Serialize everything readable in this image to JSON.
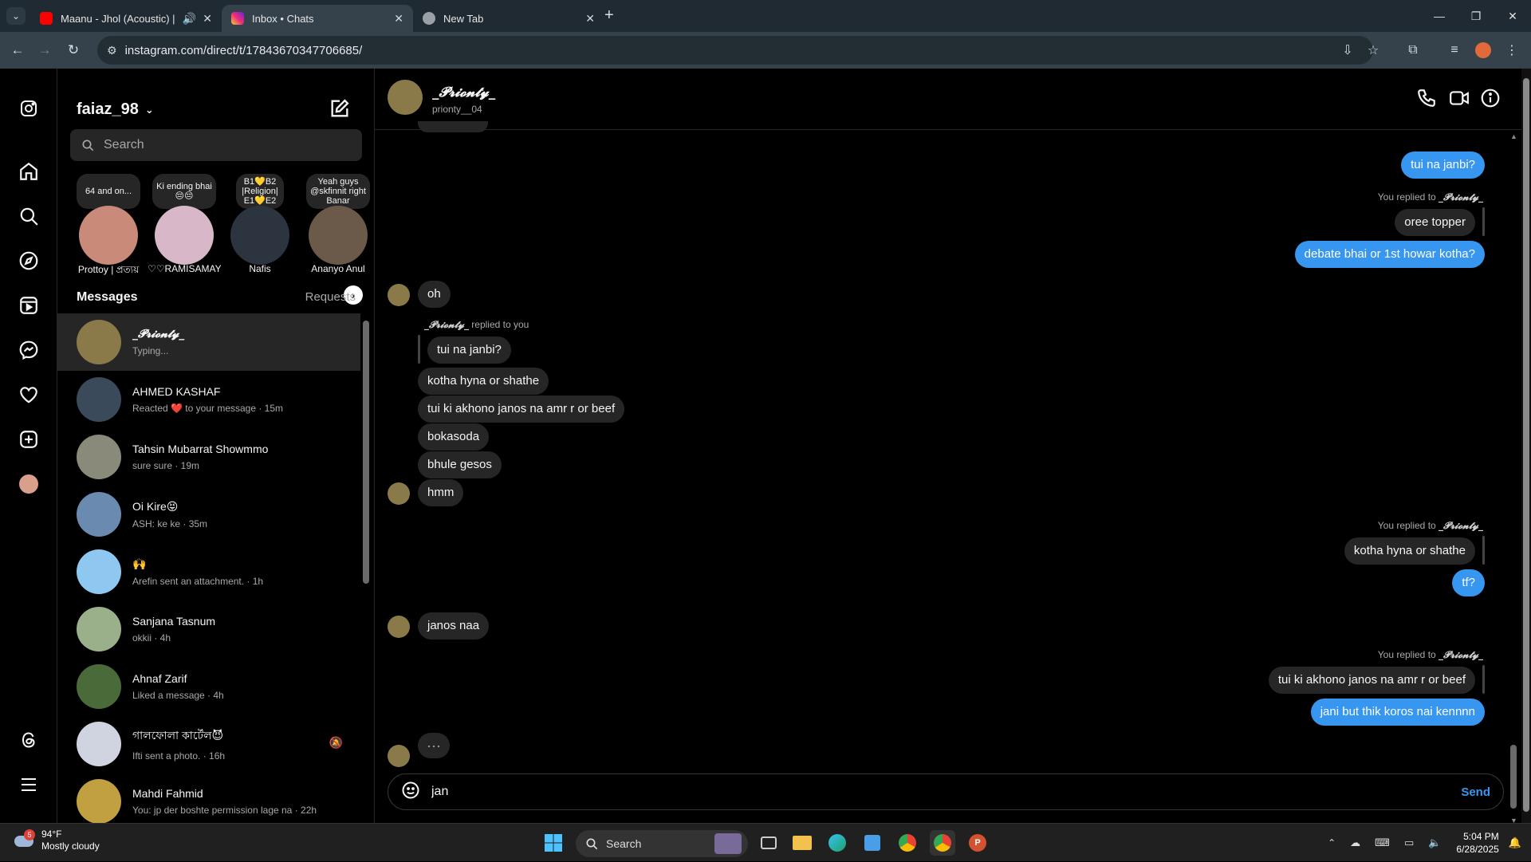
{
  "browser": {
    "tabs": [
      {
        "label": "Maanu - Jhol (Acoustic) | Ar",
        "favicon": "youtube-icon",
        "color": "#ff0000"
      },
      {
        "label": "Inbox • Chats",
        "favicon": "instagram-icon",
        "color": "#e1306c"
      },
      {
        "label": "New Tab",
        "favicon": "chrome-icon",
        "color": "#9aa0a6"
      }
    ],
    "new_tab": "+",
    "url": "instagram.com/direct/t/17843670347706685/"
  },
  "inbox": {
    "account": "faiaz_98",
    "search_placeholder": "Search",
    "notes": [
      {
        "text": "64 and on...",
        "name": "Prottoy | প্রত্যয়",
        "color": "#c98a7a"
      },
      {
        "text": "Ki ending bhai 😔😔",
        "name": "♡♡RAMISAMAY...",
        "color": "#d8b8c8"
      },
      {
        "text": "B1💛B2 |Religion| E1💛E2",
        "name": "Nafis",
        "color": "#2c3440"
      },
      {
        "text": "Yeah guys @skfinnit right Banar",
        "name": "Ananyo Anul",
        "color": "#6b5a4a"
      }
    ],
    "messages_label": "Messages",
    "requests_label": "Requests",
    "threads": [
      {
        "name": "_𝓟𝓻𝓲𝓸𝓷𝓽𝔂_",
        "preview": "Typing...",
        "color": "#8a7a4a",
        "active": true
      },
      {
        "name": "AHMED KASHAF",
        "preview": "Reacted ❤️ to your message · 15m",
        "color": "#3a4a5a"
      },
      {
        "name": "Tahsin Mubarrat Showmmo",
        "preview": "sure sure · 19m",
        "color": "#8a8a7a"
      },
      {
        "name": "Oi Kire😝",
        "preview": "ASH: ke ke · 35m",
        "color": "#6a8ab0"
      },
      {
        "name": "🙌",
        "preview": "Arefin sent an attachment. · 1h",
        "color": "#8ec7f0"
      },
      {
        "name": "Sanjana Tasnum",
        "preview": "okkii · 4h",
        "color": "#9ab08a"
      },
      {
        "name": "Ahnaf Zarif",
        "preview": "Liked a message · 4h",
        "color": "#4a6a3a"
      },
      {
        "name": "গালফোলা কার্টেল😈",
        "preview": "Ifti sent a photo. · 16h",
        "color": "#d0d4e0",
        "muted": true
      },
      {
        "name": "Mahdi Fahmid",
        "preview": "You: jp der boshte permission lage na · 22h",
        "color": "#c0a040"
      }
    ]
  },
  "chat": {
    "name": "_𝓟𝓻𝓲𝓸𝓷𝓽𝔂_",
    "username": "prionty__04",
    "reply_name": "_𝓟𝓻𝓲𝓸𝓷𝓽𝔂_",
    "you_replied": "You replied to",
    "replied_to_you": "replied to you",
    "m1": "tui na janbi?",
    "q1": "oree topper",
    "m2": "debate bhai or 1st howar kotha?",
    "m3": "oh",
    "q2": "tui na janbi?",
    "m4": "kotha hyna   or shathe",
    "m5": "tui ki akhono janos na amr r or beef",
    "m6": "bokasoda",
    "m7": "bhule gesos",
    "m8": "hmm",
    "q3": "kotha hyna or shathe",
    "m9": "tf?",
    "m10": "janos naa",
    "q4": "tui ki akhono janos na amr r or beef",
    "m11": "jani but thik koros nai kennnn",
    "typing": "···",
    "draft": "jan",
    "send": "Send"
  },
  "taskbar": {
    "temp": "94°F",
    "weather": "Mostly cloudy",
    "badge": "5",
    "search": "Search",
    "time": "5:04 PM",
    "date": "6/28/2025"
  }
}
